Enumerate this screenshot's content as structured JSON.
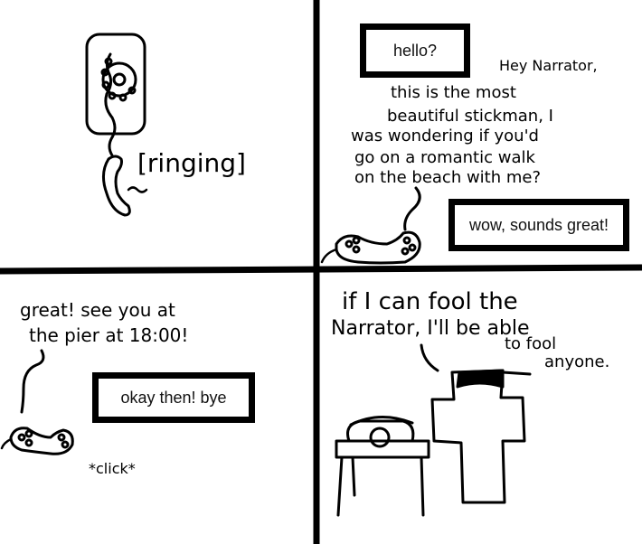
{
  "panel1": {
    "ringing": "[ringing]"
  },
  "panel2": {
    "narrator_line": "hello?",
    "stickman_greeting": "Hey Narrator,",
    "stickman_lines": [
      "this is the most",
      "beautiful stickman, I",
      "was wondering if you'd",
      "go on a romantic walk",
      "on the beach with me?"
    ],
    "narrator_reply": "wow, sounds great!"
  },
  "panel3": {
    "stickman_lines": [
      "great! see you at",
      "the pier at 18:00!"
    ],
    "narrator_line": "okay then! bye",
    "sfx": "*click*"
  },
  "panel4": {
    "thought_lines": [
      "if I can fool the",
      "Narrator, I'll be able",
      "to fool",
      "anyone."
    ]
  }
}
